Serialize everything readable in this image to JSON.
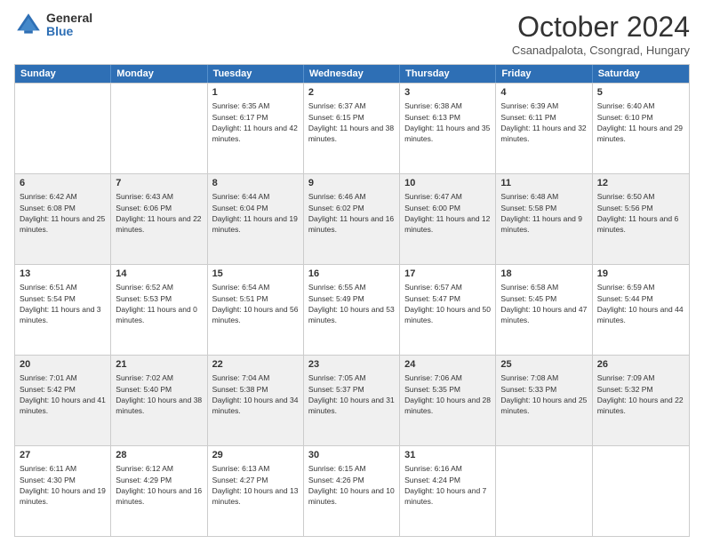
{
  "header": {
    "logo_general": "General",
    "logo_blue": "Blue",
    "title": "October 2024",
    "location": "Csanadpalota, Csongrad, Hungary"
  },
  "days_of_week": [
    "Sunday",
    "Monday",
    "Tuesday",
    "Wednesday",
    "Thursday",
    "Friday",
    "Saturday"
  ],
  "weeks": [
    [
      {
        "day": "",
        "info": ""
      },
      {
        "day": "",
        "info": ""
      },
      {
        "day": "1",
        "info": "Sunrise: 6:35 AM\nSunset: 6:17 PM\nDaylight: 11 hours and 42 minutes."
      },
      {
        "day": "2",
        "info": "Sunrise: 6:37 AM\nSunset: 6:15 PM\nDaylight: 11 hours and 38 minutes."
      },
      {
        "day": "3",
        "info": "Sunrise: 6:38 AM\nSunset: 6:13 PM\nDaylight: 11 hours and 35 minutes."
      },
      {
        "day": "4",
        "info": "Sunrise: 6:39 AM\nSunset: 6:11 PM\nDaylight: 11 hours and 32 minutes."
      },
      {
        "day": "5",
        "info": "Sunrise: 6:40 AM\nSunset: 6:10 PM\nDaylight: 11 hours and 29 minutes."
      }
    ],
    [
      {
        "day": "6",
        "info": "Sunrise: 6:42 AM\nSunset: 6:08 PM\nDaylight: 11 hours and 25 minutes."
      },
      {
        "day": "7",
        "info": "Sunrise: 6:43 AM\nSunset: 6:06 PM\nDaylight: 11 hours and 22 minutes."
      },
      {
        "day": "8",
        "info": "Sunrise: 6:44 AM\nSunset: 6:04 PM\nDaylight: 11 hours and 19 minutes."
      },
      {
        "day": "9",
        "info": "Sunrise: 6:46 AM\nSunset: 6:02 PM\nDaylight: 11 hours and 16 minutes."
      },
      {
        "day": "10",
        "info": "Sunrise: 6:47 AM\nSunset: 6:00 PM\nDaylight: 11 hours and 12 minutes."
      },
      {
        "day": "11",
        "info": "Sunrise: 6:48 AM\nSunset: 5:58 PM\nDaylight: 11 hours and 9 minutes."
      },
      {
        "day": "12",
        "info": "Sunrise: 6:50 AM\nSunset: 5:56 PM\nDaylight: 11 hours and 6 minutes."
      }
    ],
    [
      {
        "day": "13",
        "info": "Sunrise: 6:51 AM\nSunset: 5:54 PM\nDaylight: 11 hours and 3 minutes."
      },
      {
        "day": "14",
        "info": "Sunrise: 6:52 AM\nSunset: 5:53 PM\nDaylight: 11 hours and 0 minutes."
      },
      {
        "day": "15",
        "info": "Sunrise: 6:54 AM\nSunset: 5:51 PM\nDaylight: 10 hours and 56 minutes."
      },
      {
        "day": "16",
        "info": "Sunrise: 6:55 AM\nSunset: 5:49 PM\nDaylight: 10 hours and 53 minutes."
      },
      {
        "day": "17",
        "info": "Sunrise: 6:57 AM\nSunset: 5:47 PM\nDaylight: 10 hours and 50 minutes."
      },
      {
        "day": "18",
        "info": "Sunrise: 6:58 AM\nSunset: 5:45 PM\nDaylight: 10 hours and 47 minutes."
      },
      {
        "day": "19",
        "info": "Sunrise: 6:59 AM\nSunset: 5:44 PM\nDaylight: 10 hours and 44 minutes."
      }
    ],
    [
      {
        "day": "20",
        "info": "Sunrise: 7:01 AM\nSunset: 5:42 PM\nDaylight: 10 hours and 41 minutes."
      },
      {
        "day": "21",
        "info": "Sunrise: 7:02 AM\nSunset: 5:40 PM\nDaylight: 10 hours and 38 minutes."
      },
      {
        "day": "22",
        "info": "Sunrise: 7:04 AM\nSunset: 5:38 PM\nDaylight: 10 hours and 34 minutes."
      },
      {
        "day": "23",
        "info": "Sunrise: 7:05 AM\nSunset: 5:37 PM\nDaylight: 10 hours and 31 minutes."
      },
      {
        "day": "24",
        "info": "Sunrise: 7:06 AM\nSunset: 5:35 PM\nDaylight: 10 hours and 28 minutes."
      },
      {
        "day": "25",
        "info": "Sunrise: 7:08 AM\nSunset: 5:33 PM\nDaylight: 10 hours and 25 minutes."
      },
      {
        "day": "26",
        "info": "Sunrise: 7:09 AM\nSunset: 5:32 PM\nDaylight: 10 hours and 22 minutes."
      }
    ],
    [
      {
        "day": "27",
        "info": "Sunrise: 6:11 AM\nSunset: 4:30 PM\nDaylight: 10 hours and 19 minutes."
      },
      {
        "day": "28",
        "info": "Sunrise: 6:12 AM\nSunset: 4:29 PM\nDaylight: 10 hours and 16 minutes."
      },
      {
        "day": "29",
        "info": "Sunrise: 6:13 AM\nSunset: 4:27 PM\nDaylight: 10 hours and 13 minutes."
      },
      {
        "day": "30",
        "info": "Sunrise: 6:15 AM\nSunset: 4:26 PM\nDaylight: 10 hours and 10 minutes."
      },
      {
        "day": "31",
        "info": "Sunrise: 6:16 AM\nSunset: 4:24 PM\nDaylight: 10 hours and 7 minutes."
      },
      {
        "day": "",
        "info": ""
      },
      {
        "day": "",
        "info": ""
      }
    ]
  ]
}
